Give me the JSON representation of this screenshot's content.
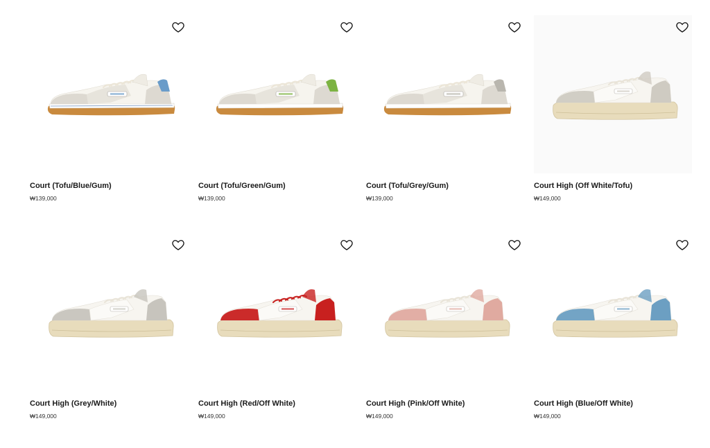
{
  "products": [
    {
      "name": "Court (Tofu/Blue/Gum)",
      "price": "₩139,000",
      "style": "low",
      "accent": "#6a9cc9",
      "sole": "gum"
    },
    {
      "name": "Court (Tofu/Green/Gum)",
      "price": "₩139,000",
      "style": "low",
      "accent": "#7cb342",
      "sole": "gum"
    },
    {
      "name": "Court (Tofu/Grey/Gum)",
      "price": "₩139,000",
      "style": "low",
      "accent": "#b9b6ae",
      "sole": "gum"
    },
    {
      "name": "Court High (Off White/Tofu)",
      "price": "₩149,000",
      "style": "high",
      "accent": "#cfcbc2",
      "sole": "cream"
    },
    {
      "name": "Court High (Grey/White)",
      "price": "₩149,000",
      "style": "high",
      "accent": "#c7c4bd",
      "sole": "cream"
    },
    {
      "name": "Court High (Red/Off White)",
      "price": "₩149,000",
      "style": "high",
      "accent": "#c8201f",
      "sole": "cream"
    },
    {
      "name": "Court High (Pink/Off White)",
      "price": "₩149,000",
      "style": "high",
      "accent": "#e0aaa0",
      "sole": "cream"
    },
    {
      "name": "Court High (Blue/Off White)",
      "price": "₩149,000",
      "style": "high",
      "accent": "#6c9fc2",
      "sole": "cream"
    }
  ],
  "icons": {
    "favorite": "heart-outline-icon"
  }
}
